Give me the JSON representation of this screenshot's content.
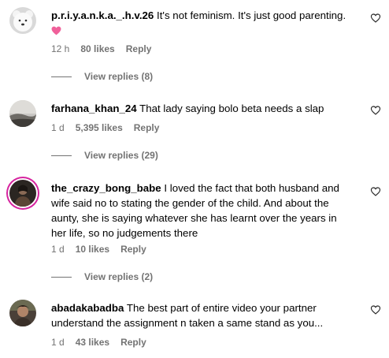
{
  "comments": [
    {
      "username": "p.r.i.y.a.n.k.a._.h.v.26",
      "text": "It's not feminism. It's just good parenting.",
      "time": "12 h",
      "likes": "80 likes",
      "reply_label": "Reply",
      "view_replies": "View replies (8)",
      "emoji": "pink-heart",
      "avatar_icon": "teddy-bear-avatar"
    },
    {
      "username": "farhana_khan_24",
      "text": "That lady saying bolo beta needs a slap",
      "time": "1 d",
      "likes": "5,395 likes",
      "reply_label": "Reply",
      "view_replies": "View replies (29)",
      "avatar_icon": "landscape-avatar"
    },
    {
      "username": "the_crazy_bong_babe",
      "text": "I loved the fact that both husband and wife said no to stating the gender of the child. And about the aunty, she is saying whatever she has learnt over the years in her life, so no judgements there",
      "time": "1 d",
      "likes": "10 likes",
      "reply_label": "Reply",
      "view_replies": "View replies (2)",
      "avatar_icon": "person-photo-avatar"
    },
    {
      "username": "abadakabadba",
      "text": "The best part of entire video your partner understand the assignment n taken a same stand as you...",
      "time": "1 d",
      "likes": "43 likes",
      "reply_label": "Reply",
      "avatar_icon": "person-photo-avatar"
    }
  ],
  "colors": {
    "meta": "#737373",
    "story_ring": "#d6249f",
    "emoji_heart": "#f0609a"
  }
}
